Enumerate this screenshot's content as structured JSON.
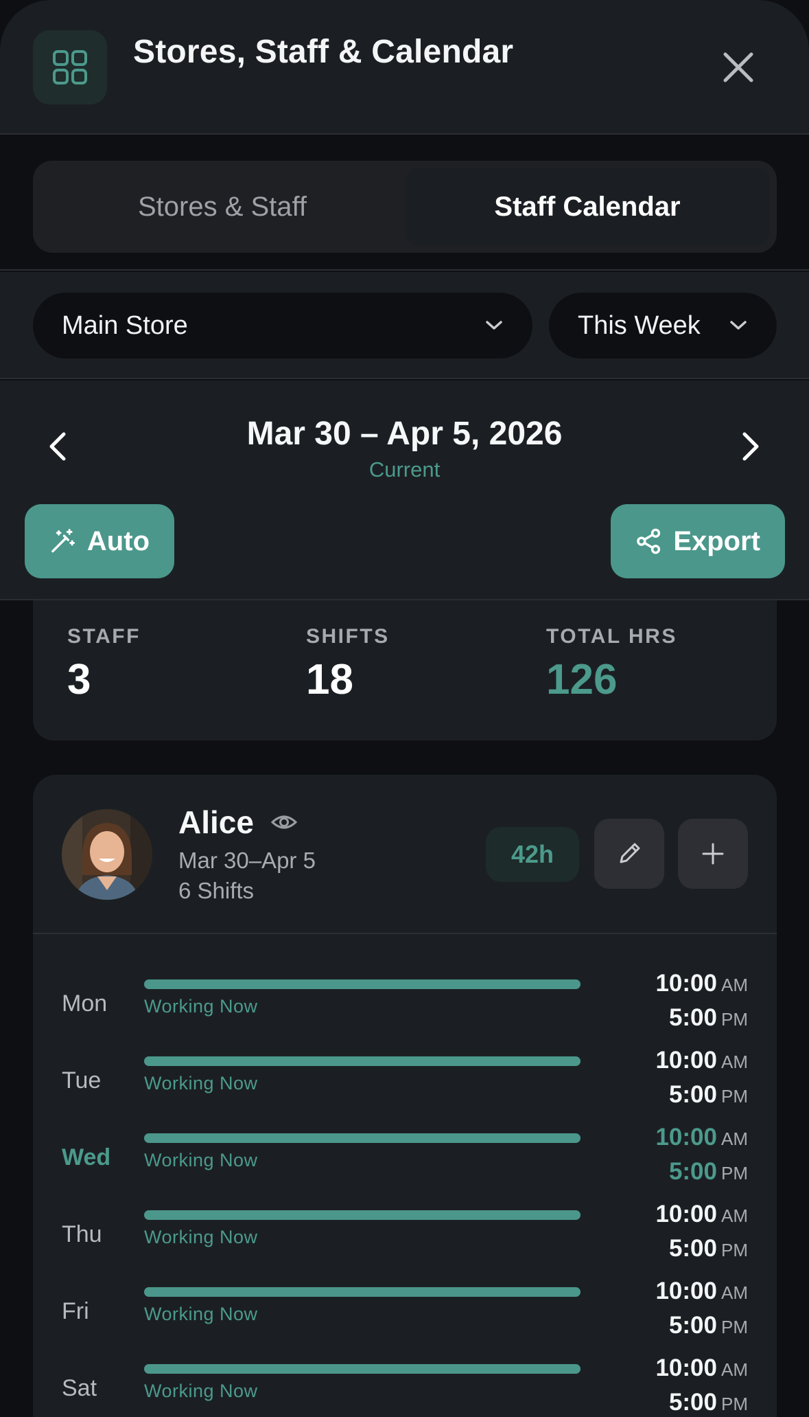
{
  "header": {
    "title": "Stores, Staff & Calendar",
    "app_icon": "grid-icon",
    "close_icon": "close-icon"
  },
  "tabs": [
    {
      "label": "Stores & Staff",
      "active": false
    },
    {
      "label": "Staff Calendar",
      "active": true
    }
  ],
  "filters": {
    "store": "Main Store",
    "period": "This Week"
  },
  "week": {
    "range": "Mar 30 – Apr 5, 2026",
    "status": "Current"
  },
  "actions": {
    "auto_label": "Auto",
    "export_label": "Export"
  },
  "stats": [
    {
      "label": "STAFF",
      "value": "3"
    },
    {
      "label": "SHIFTS",
      "value": "18"
    },
    {
      "label": "TOTAL HRS",
      "value": "126"
    }
  ],
  "staff": {
    "name": "Alice",
    "range": "Mar 30–Apr 5",
    "shifts": "6 Shifts",
    "hours": "42h",
    "days": [
      {
        "day": "Mon",
        "status": "Working Now",
        "start": "10:00",
        "start_ampm": "AM",
        "end": "5:00",
        "end_ampm": "PM",
        "today": false
      },
      {
        "day": "Tue",
        "status": "Working Now",
        "start": "10:00",
        "start_ampm": "AM",
        "end": "5:00",
        "end_ampm": "PM",
        "today": false
      },
      {
        "day": "Wed",
        "status": "Working Now",
        "start": "10:00",
        "start_ampm": "AM",
        "end": "5:00",
        "end_ampm": "PM",
        "today": true
      },
      {
        "day": "Thu",
        "status": "Working Now",
        "start": "10:00",
        "start_ampm": "AM",
        "end": "5:00",
        "end_ampm": "PM",
        "today": false
      },
      {
        "day": "Fri",
        "status": "Working Now",
        "start": "10:00",
        "start_ampm": "AM",
        "end": "5:00",
        "end_ampm": "PM",
        "today": false
      },
      {
        "day": "Sat",
        "status": "Working Now",
        "start": "10:00",
        "start_ampm": "AM",
        "end": "5:00",
        "end_ampm": "PM",
        "today": false
      }
    ]
  },
  "colors": {
    "accent": "#4b978b",
    "background": "#0e0f13",
    "surface": "#1b1f23"
  }
}
